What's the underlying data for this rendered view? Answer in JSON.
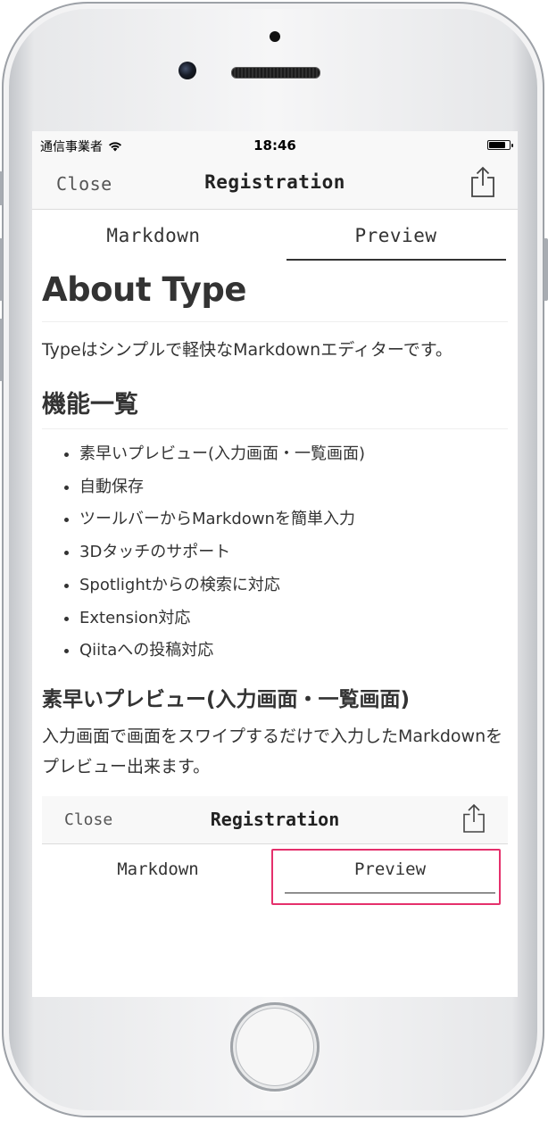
{
  "status_bar": {
    "carrier": "通信事業者",
    "time": "18:46",
    "battery_level": 0.8
  },
  "nav": {
    "close_label": "Close",
    "title": "Registration",
    "share_icon": "share-icon"
  },
  "tabs": {
    "markdown_label": "Markdown",
    "preview_label": "Preview",
    "selected": "Preview"
  },
  "document": {
    "h1": "About Type",
    "intro": "Typeはシンプルで軽快なMarkdownエディターです。",
    "h2": "機能一覧",
    "features": [
      "素早いプレビュー(入力画面・一覧画面)",
      "自動保存",
      "ツールバーからMarkdownを簡単入力",
      "3Dタッチのサポート",
      "Spotlightからの検索に対応",
      "Extension対応",
      "Qiitaへの投稿対応"
    ],
    "h3": "素早いプレビュー(入力画面・一覧画面)",
    "h3_body": "入力画面で画面をスワイプするだけで入力したMarkdownをプレビュー出来ます。"
  },
  "embedded_screenshot": {
    "close_label": "Close",
    "title": "Registration",
    "markdown_label": "Markdown",
    "preview_label": "Preview",
    "highlight_color": "#e5306c"
  }
}
